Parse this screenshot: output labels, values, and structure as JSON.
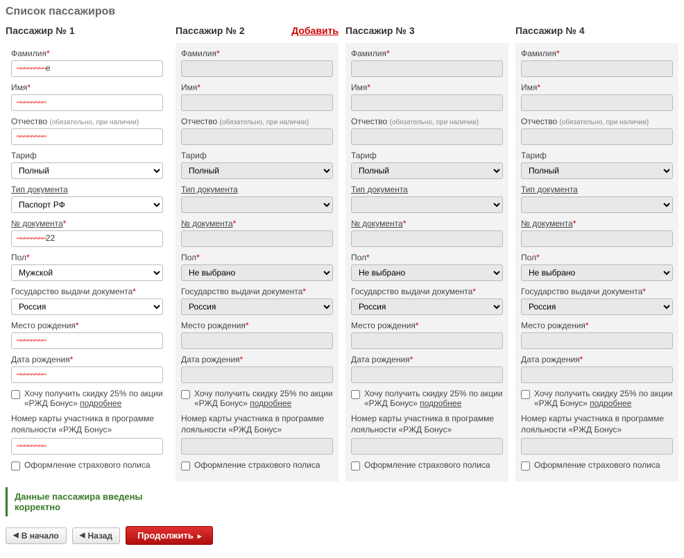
{
  "title": "Список пассажиров",
  "add_label": "Добавить",
  "labels": {
    "surname": "Фамилия",
    "name": "Имя",
    "patronymic": "Отчество",
    "patronymic_hint": "(обязательно, при наличии)",
    "tariff": "Тариф",
    "doc_type": "Тип документа",
    "doc_number": "№ документа",
    "gender": "Пол",
    "doc_country": "Государство выдачи документа",
    "birthplace": "Место рождения",
    "birthdate": "Дата рождения",
    "discount": "Хочу получить скидку 25% по акции «РЖД Бонус»",
    "more": "подробнее",
    "bonus_card": "Номер карты участника в программе лояльности «РЖД Бонус»",
    "insurance": "Оформление страхового полиса"
  },
  "passengers": [
    {
      "header": "Пассажир № 1",
      "active": true,
      "surname": "████████e",
      "name": "████████",
      "patronymic": "████████",
      "tariff": "Полный",
      "doc_type": "Паспорт РФ",
      "doc_number": "████████22",
      "gender": "Мужской",
      "doc_country": "Россия",
      "birthplace": "████████",
      "birthdate": "████████",
      "bonus_card": "████████"
    },
    {
      "header": "Пассажир № 2",
      "active": false,
      "has_add": true,
      "tariff": "Полный",
      "gender": "Не выбрано",
      "doc_country": "Россия"
    },
    {
      "header": "Пассажир № 3",
      "active": false,
      "tariff": "Полный",
      "gender": "Не выбрано",
      "doc_country": "Россия"
    },
    {
      "header": "Пассажир № 4",
      "active": false,
      "tariff": "Полный",
      "gender": "Не выбрано",
      "doc_country": "Россия"
    }
  ],
  "valid_msg": "Данные пассажира введены корректно",
  "nav": {
    "start": "В начало",
    "back": "Назад",
    "continue": "Продолжить"
  }
}
